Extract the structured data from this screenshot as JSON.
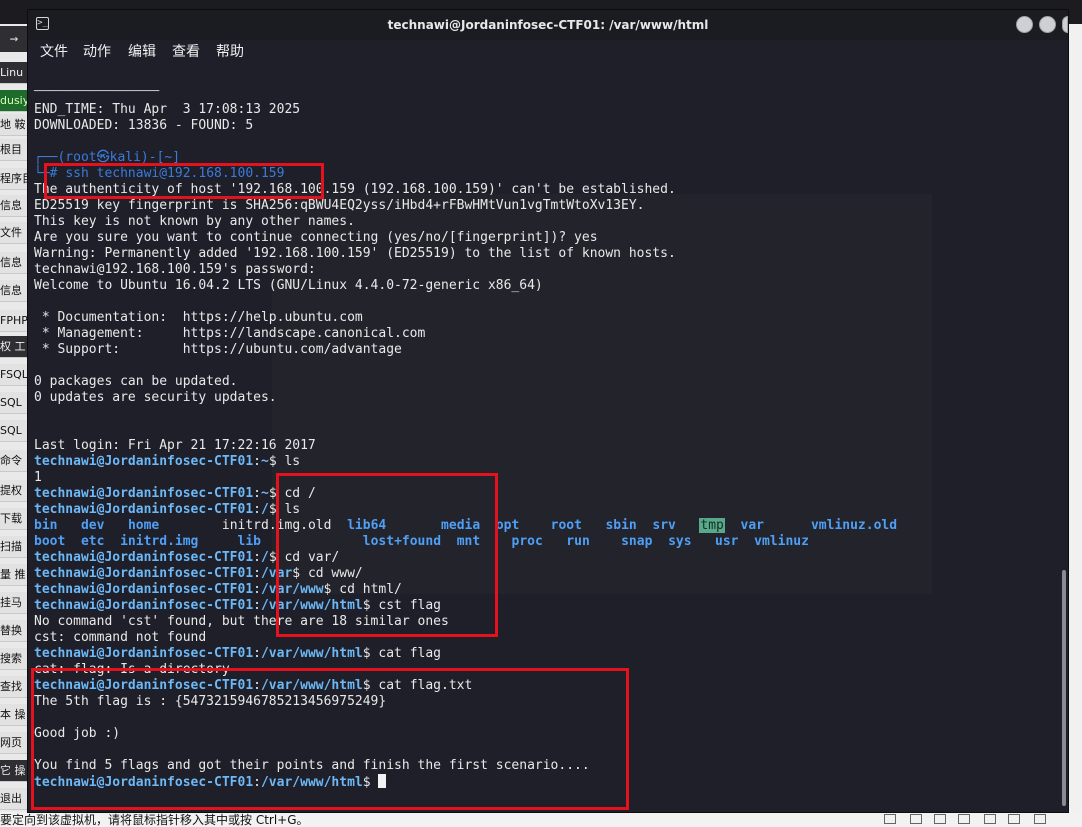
{
  "window": {
    "title": "technawi@Jordaninfosec-CTF01: /var/www/html"
  },
  "menu": {
    "file": "文件",
    "actions": "动作",
    "edit": "编辑",
    "view": "查看",
    "help": "帮助"
  },
  "terminal": {
    "lines": {
      "l01": "END_TIME: Thu Apr  3 17:08:13 2025",
      "l02": "DOWNLOADED: 13836 - FOUND: 5",
      "kali_prompt_top": "┌──(root㉿kali)-[~]",
      "kali_prompt_hash": "└─#",
      "ssh_cmd": "ssh technawi@192.168.100.159",
      "l05": "The authenticity of host '192.168.100.159 (192.168.100.159)' can't be established.",
      "l06": "ED25519 key fingerprint is SHA256:qBWU4EQ2yss/iHbd4+rFBwHMtVun1vgTmtWtoXv13EY.",
      "l07": "This key is not known by any other names.",
      "l08": "Are you sure you want to continue connecting (yes/no/[fingerprint])? yes",
      "l09": "Warning: Permanently added '192.168.100.159' (ED25519) to the list of known hosts.",
      "l10": "technawi@192.168.100.159's password:",
      "l11": "Welcome to Ubuntu 16.04.2 LTS (GNU/Linux 4.4.0-72-generic x86_64)",
      "l13": " * Documentation:  https://help.ubuntu.com",
      "l14": " * Management:     https://landscape.canonical.com",
      "l15": " * Support:        https://ubuntu.com/advantage",
      "l17": "0 packages can be updated.",
      "l18": "0 updates are security updates.",
      "l21": "Last login: Fri Apr 21 17:22:16 2017",
      "l23": "1",
      "l31": "No command 'cst' found, but there are 18 similar ones",
      "l32": "cst: command not found",
      "l34": "cat: flag: Is a directory",
      "l36": "The 5th flag is : {5473215946785213456975249}",
      "l38": "Good job :)",
      "l40": "You find 5 flags and got their points and finish the first scenario...."
    },
    "prompt_user_host": "technawi@Jordaninfosec-CTF01",
    "paths": {
      "home": "~",
      "root": "/",
      "var": "/var",
      "var_www": "/var/www",
      "var_www_html": "/var/www/html"
    },
    "commands": {
      "c22": "ls",
      "c24": "cd /",
      "c25": "ls",
      "c28": "cd var/",
      "c29": "cd www/",
      "c30": "cd html/",
      "c31": "cst flag",
      "c33": "cat flag",
      "c35": "cat flag.txt"
    },
    "ls_root": {
      "row1": [
        "bin",
        "dev",
        "home",
        "initrd.img.old",
        "lib64",
        "media",
        "opt",
        "root",
        "sbin",
        "srv",
        "tmp",
        "var",
        "vmlinuz.old"
      ],
      "row2": [
        "boot",
        "etc",
        "initrd.img",
        "lib",
        "lost+found",
        "mnt",
        "proc",
        "run",
        "snap",
        "sys",
        "usr",
        "vmlinuz"
      ]
    }
  },
  "background": {
    "sidebar_items": [
      "Linu",
      "dusiy",
      "地 鞍",
      "根目",
      "程序目",
      "信息",
      "文件",
      "信息",
      "信息",
      "FPHP",
      "权 工",
      "FSQL",
      "SQL",
      "SQL",
      "命令",
      "提权",
      "下载",
      "扫描",
      "量 推",
      "挂马",
      "替换",
      "搜索",
      "查找",
      "本 操",
      "网页",
      "它 操",
      "退出"
    ],
    "bottom_text": "要定向到该虚拟机，请将鼠标指针移入其中或按 Ctrl+G。"
  },
  "colors": {
    "terminal_bg": "#1e1f29",
    "prompt_green": "#6db8f6",
    "dir_blue": "#4f9ff5",
    "highlight_red": "#e4121c"
  }
}
